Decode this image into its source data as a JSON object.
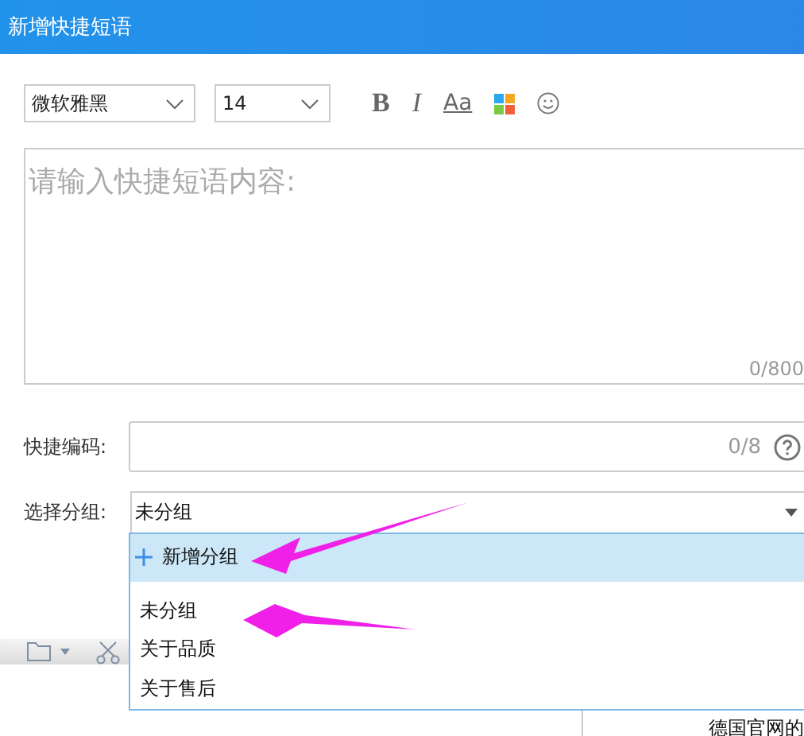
{
  "window": {
    "title": "新增快捷短语"
  },
  "toolbar": {
    "font": "微软雅黑",
    "size": "14",
    "bold_label": "B",
    "italic_label": "I",
    "case_label": "Aa"
  },
  "content": {
    "placeholder": "请输入快捷短语内容:",
    "counter": "0/800"
  },
  "code_field": {
    "label": "快捷编码:",
    "counter": "0/8"
  },
  "group_field": {
    "label": "选择分组:",
    "value": "未分组",
    "expanded": true
  },
  "dropdown": {
    "add_label": "新增分组",
    "items": [
      "未分组",
      "关于品质",
      "关于售后"
    ]
  },
  "background": {
    "snippet": "德国官网的"
  }
}
